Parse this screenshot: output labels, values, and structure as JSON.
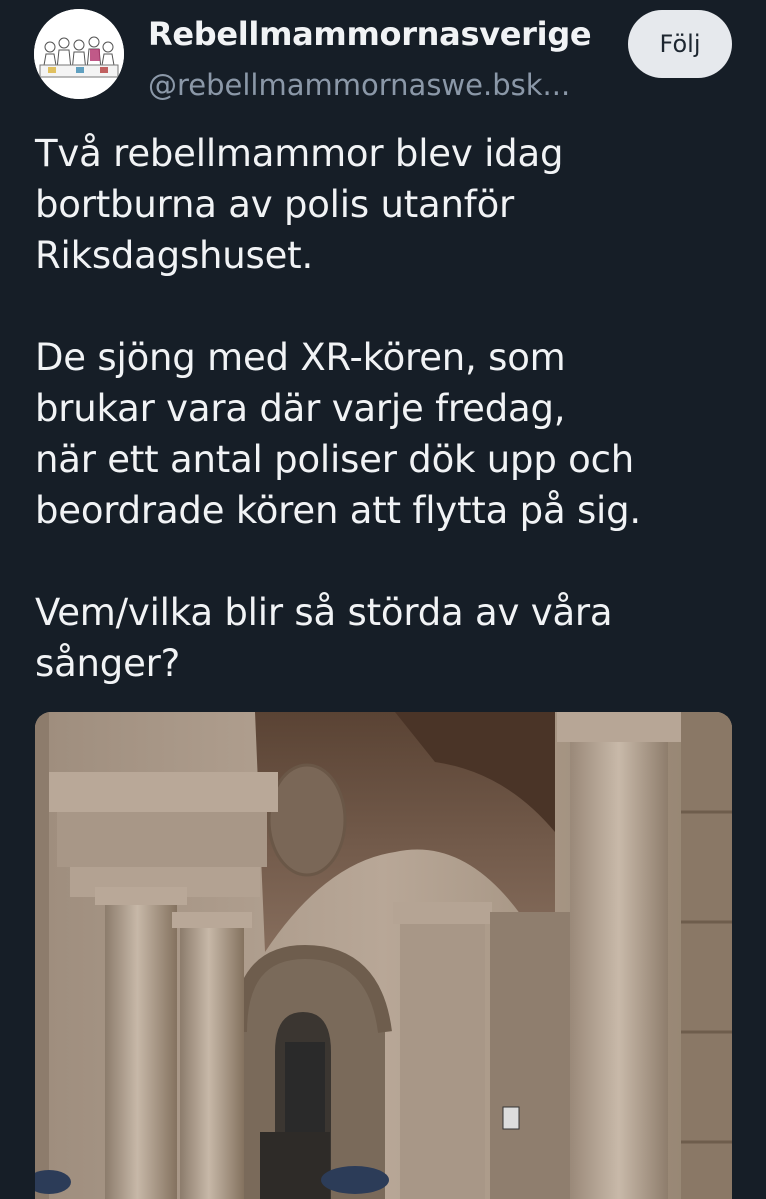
{
  "author": {
    "display_name": "Rebellmammornasverige",
    "handle": "@rebellmammornaswe.bsk..."
  },
  "follow_button": {
    "label": "Följ"
  },
  "post": {
    "paragraphs": [
      [
        "Två rebellmammor blev idag",
        "bortburna av polis utanför",
        "Riksdagshuset."
      ],
      [
        "De sjöng med XR-kören, som",
        "brukar vara där varje fredag,",
        "när ett antal poliser dök upp och",
        "beordrade kören att flytta på sig."
      ],
      [
        "Vem/vilka blir så störda av våra",
        "sånger?"
      ]
    ]
  },
  "colors": {
    "background": "#161e27",
    "text_primary": "#f1f3f5",
    "text_secondary": "#8b98a8",
    "follow_button_bg": "#e6e9ed"
  },
  "icons": {
    "avatar": "group-of-women-illustration"
  }
}
